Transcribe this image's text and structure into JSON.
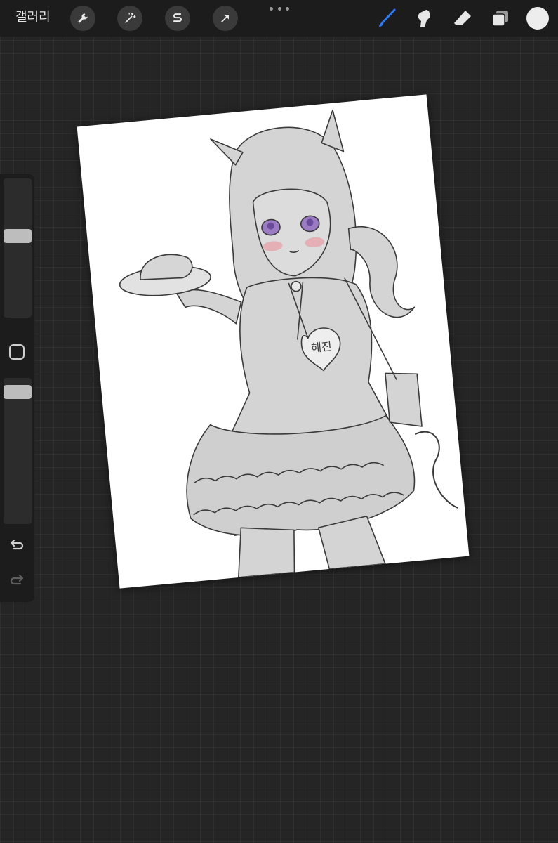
{
  "topbar": {
    "gallery_label": "갤러리",
    "actions": [
      {
        "name": "actions",
        "icon": "wrench-icon"
      },
      {
        "name": "adjustments",
        "icon": "magic-wand-icon"
      },
      {
        "name": "selection",
        "icon": "selection-s-icon"
      },
      {
        "name": "transform",
        "icon": "arrow-cursor-icon"
      }
    ],
    "tools": [
      {
        "name": "brush",
        "icon": "brush-icon",
        "active": true
      },
      {
        "name": "smudge",
        "icon": "smudge-icon",
        "active": false
      },
      {
        "name": "eraser",
        "icon": "eraser-icon",
        "active": false
      },
      {
        "name": "layers",
        "icon": "layers-icon",
        "active": false
      }
    ],
    "current_color": "#ededed",
    "active_tool_color": "#2b7bf3"
  },
  "sidebar": {
    "brush_size_level": 0.58,
    "opacity_level": 0.9,
    "undo_icon": "undo-icon",
    "redo_icon": "redo-icon"
  },
  "canvas": {
    "badge_text": "혜진",
    "background": "#ffffff"
  }
}
